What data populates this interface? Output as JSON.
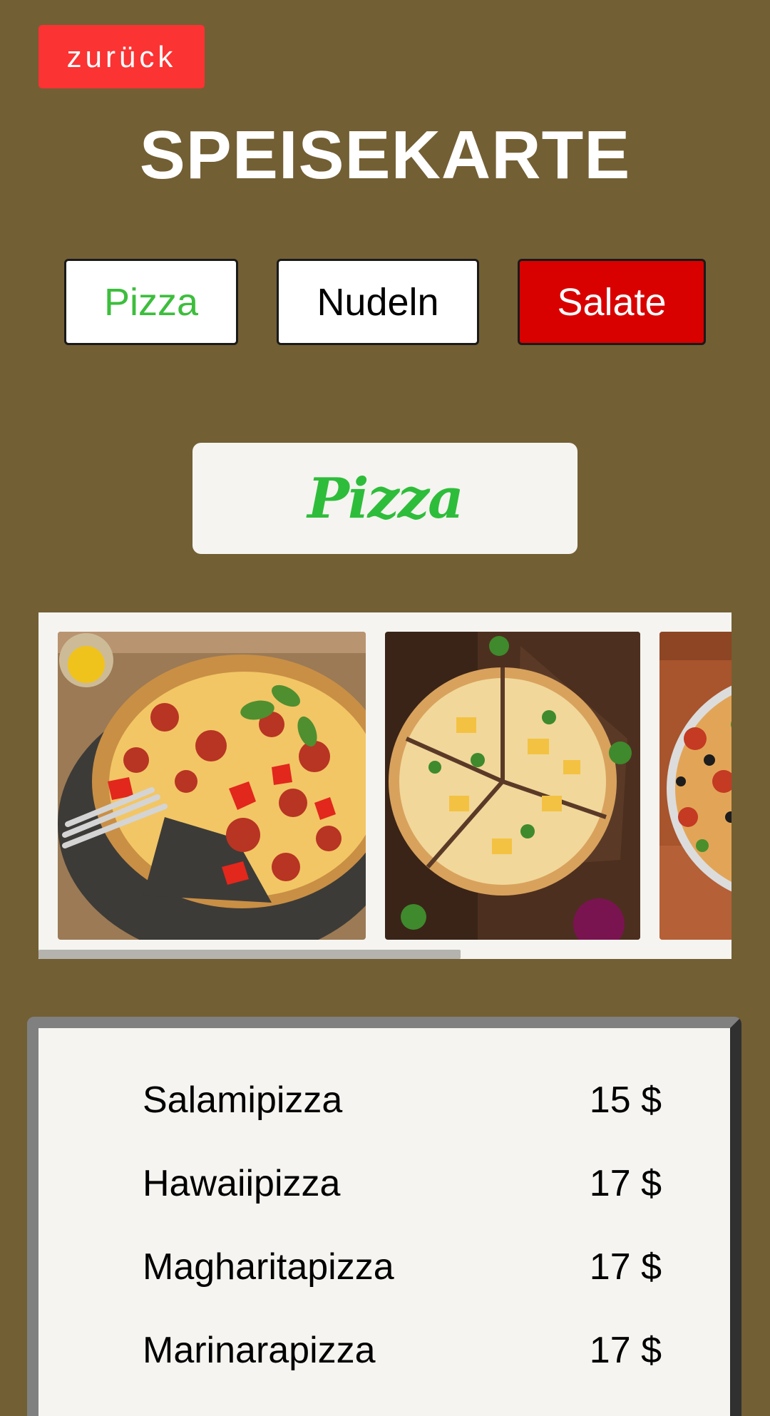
{
  "nav": {
    "back_label": "zurück"
  },
  "page": {
    "title": "SPEISEKARTE"
  },
  "tabs": [
    {
      "label": "Pizza",
      "color": "#3dbe3d",
      "background": "#ffffff"
    },
    {
      "label": "Nudeln",
      "color": "#000000",
      "background": "#ffffff"
    },
    {
      "label": "Salate",
      "color": "#ffffff",
      "background": "#d90000"
    }
  ],
  "section": {
    "title": "Pizza"
  },
  "gallery": {
    "images": [
      {
        "name": "salami-pizza-photo"
      },
      {
        "name": "hawaii-pizza-photo"
      },
      {
        "name": "olive-pizza-photo"
      }
    ],
    "scroll_position_fraction": 0.0,
    "visible_fraction": 0.61
  },
  "menu": {
    "items": [
      {
        "name": "Salamipizza",
        "price": "15 $"
      },
      {
        "name": "Hawaiipizza",
        "price": "17 $"
      },
      {
        "name": "Magharitapizza",
        "price": "17 $"
      },
      {
        "name": "Marinarapizza",
        "price": "17 $"
      }
    ]
  },
  "colors": {
    "background": "#735f34",
    "back_button": "#fb3333",
    "accent_green": "#2ebd3a",
    "salate_red": "#d90000"
  }
}
